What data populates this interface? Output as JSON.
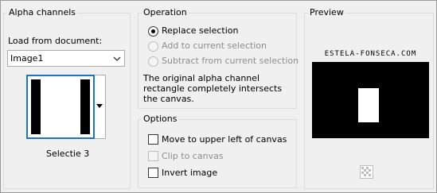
{
  "alpha_channels": {
    "title": "Alpha channels",
    "load_label": "Load from document:",
    "document_value": "Image1",
    "selection_name": "Selectie 3"
  },
  "operation": {
    "title": "Operation",
    "options": [
      {
        "label": "Replace selection",
        "selected": true,
        "enabled": true
      },
      {
        "label": "Add to current selection",
        "selected": false,
        "enabled": false
      },
      {
        "label": "Subtract from current selection",
        "selected": false,
        "enabled": false
      }
    ],
    "description": "The original alpha channel rectangle completely intersects the canvas."
  },
  "options": {
    "title": "Options",
    "items": [
      {
        "label": "Move to upper left of canvas",
        "checked": false,
        "enabled": true
      },
      {
        "label": "Clip to canvas",
        "checked": false,
        "enabled": false
      },
      {
        "label": "Invert image",
        "checked": false,
        "enabled": true
      }
    ]
  },
  "preview": {
    "title": "Preview",
    "watermark": "ESTELA-FONSECA.COM",
    "nav_icon": "navigate-checker-icon"
  }
}
